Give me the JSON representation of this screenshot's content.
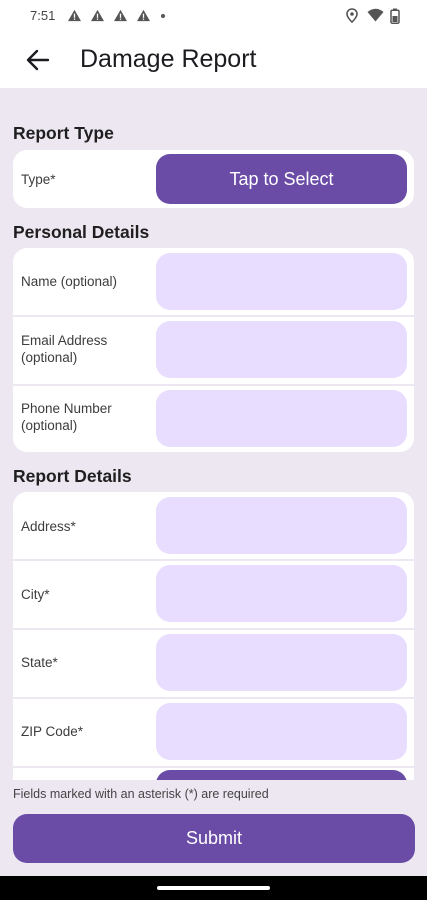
{
  "status_bar": {
    "time": "7:51"
  },
  "app_bar": {
    "title": "Damage Report"
  },
  "sections": {
    "report_type": {
      "title": "Report Type",
      "type_label": "Type*",
      "type_button": "Tap to Select"
    },
    "personal": {
      "title": "Personal Details",
      "name_label": "Name (optional)",
      "email_label": "Email Address (optional)",
      "phone_label": "Phone Number (optional)"
    },
    "report": {
      "title": "Report Details",
      "address_label": "Address*",
      "city_label": "City*",
      "state_label": "State*",
      "zip_label": "ZIP Code*"
    }
  },
  "footer": {
    "note": "Fields marked with an asterisk (*) are required",
    "submit_label": "Submit"
  },
  "colors": {
    "accent": "#6a4ca6",
    "field_fill": "#e8ddff",
    "background": "#ede7f1"
  }
}
